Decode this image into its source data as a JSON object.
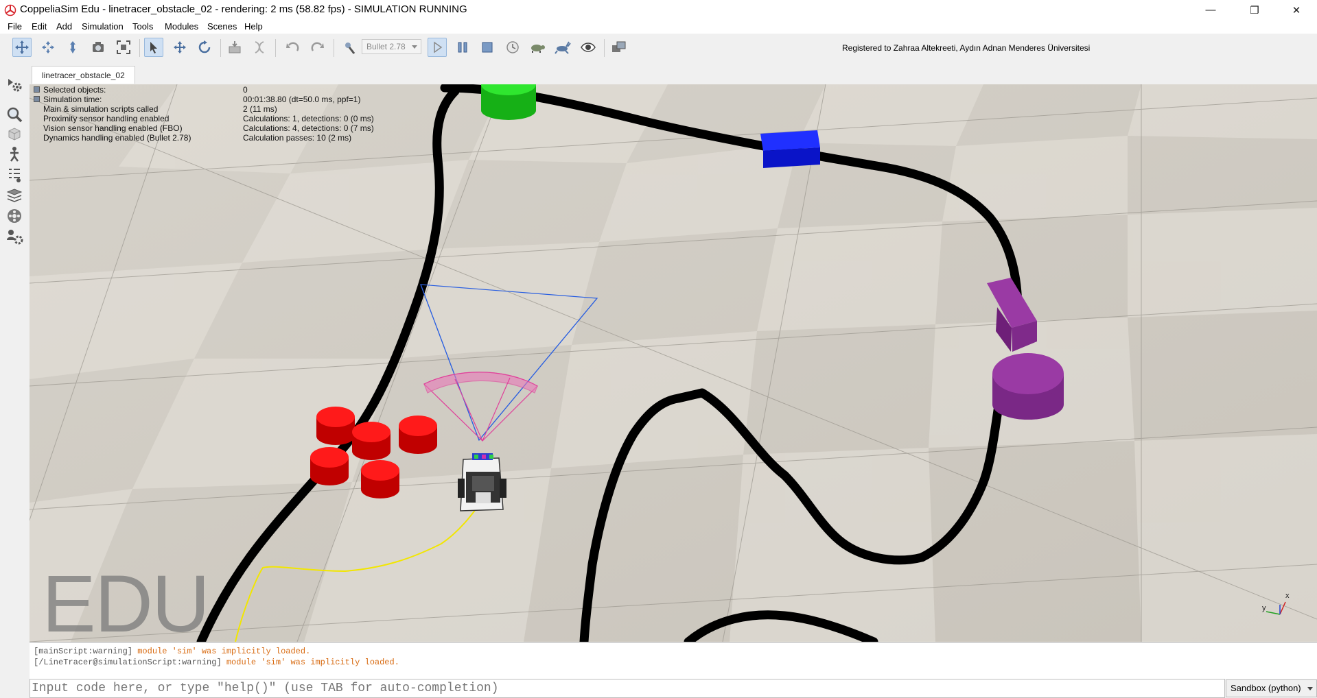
{
  "window": {
    "title": "CoppeliaSim Edu - linetracer_obstacle_02 - rendering: 2 ms (58.82 fps) - SIMULATION RUNNING",
    "minimize_glyph": "—",
    "restore_glyph": "❐",
    "close_glyph": "✕"
  },
  "menu": [
    "File",
    "Edit",
    "Add",
    "Simulation",
    "Tools",
    "Modules",
    "Scenes",
    "Help"
  ],
  "toolbar": {
    "engine": "Bullet 2.78",
    "registered": "Registered to Zahraa Altekreeti, Aydın Adnan Menderes Üniversitesi",
    "icons": [
      "camera-pan-icon",
      "camera-rotate-icon",
      "camera-shift-icon",
      "camera-angle-icon",
      "fit-to-view-icon",
      "object-select-icon",
      "object-move-icon",
      "object-rotate-icon",
      "assemble-icon",
      "transfer-dna-icon",
      "undo-icon",
      "redo-icon",
      "dynamics-settings-icon",
      "start-icon",
      "pause-icon",
      "stop-icon",
      "realtime-icon",
      "slow-down-icon",
      "speed-up-icon",
      "visualization-icon",
      "page-selector-icon"
    ]
  },
  "left_icons": [
    "scene-object-properties-icon",
    "calculation-modules-icon",
    "collections-icon",
    "scripts-icon",
    "shapes-edit-icon",
    "layers-icon",
    "video-recorder-icon",
    "user-settings-icon"
  ],
  "scene_tab": "linetracer_obstacle_02",
  "info": [
    {
      "label": "Selected objects:",
      "value": "0"
    },
    {
      "label": "Simulation time:",
      "value": "00:01:38.80 (dt=50.0 ms, ppf=1)"
    },
    {
      "label": "Main & simulation scripts called",
      "value": "2 (11 ms)"
    },
    {
      "label": "Proximity sensor handling enabled",
      "value": "Calculations: 1, detections: 0 (0 ms)"
    },
    {
      "label": "Vision sensor handling enabled (FBO)",
      "value": "Calculations: 4, detections: 0 (7 ms)"
    },
    {
      "label": "Dynamics handling enabled (Bullet 2.78)",
      "value": "Calculation passes: 10 (2 ms)"
    }
  ],
  "watermark": "EDU",
  "axes": {
    "x": "x",
    "y": "y"
  },
  "console": [
    {
      "prefix": "[mainScript:warning]",
      "msg": " module 'sim' was implicitly loaded."
    },
    {
      "prefix": "[/LineTracer@simulationScript:warning]",
      "msg": " module 'sim' was implicitly loaded."
    }
  ],
  "command_input": {
    "placeholder": "Input code here, or type \"help()\" (use TAB for auto-completion)"
  },
  "sandbox": "Sandbox (python)",
  "colors": {
    "floor_light": "#d9d5cd",
    "floor_dark": "#c2beb6",
    "track": "#000000",
    "green_cylinder": "#1fd21f",
    "blue_box": "#0a14e0",
    "purple_objects": "#8a2d94",
    "red_cylinders": "#e00000",
    "sensor_cone": "#2a5fe0",
    "proximity_sensor": "#e0409a",
    "trail": "#f2e600",
    "console_warning": "#d86a10"
  }
}
